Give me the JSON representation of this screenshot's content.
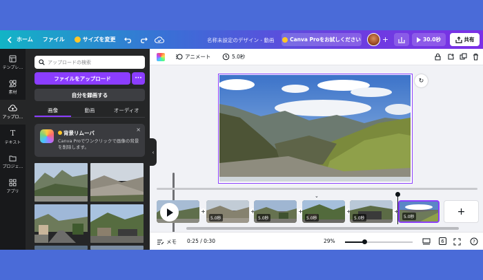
{
  "topbar": {
    "home_label": "ホーム",
    "file_label": "ファイル",
    "resize_label": "サイズを変更",
    "doc_title": "名称未設定のデザイン - 動画",
    "try_pro_label": "Canva Proをお試しください",
    "play_label": "30.0秒",
    "share_label": "共有"
  },
  "rail": {
    "items": [
      {
        "label": "テンプレ…",
        "icon": "template-icon"
      },
      {
        "label": "素材",
        "icon": "elements-icon"
      },
      {
        "label": "アップロ…",
        "icon": "upload-cloud-icon"
      },
      {
        "label": "テキスト",
        "icon": "text-icon"
      },
      {
        "label": "プロジェ…",
        "icon": "folder-icon"
      },
      {
        "label": "アプリ",
        "icon": "apps-icon"
      }
    ]
  },
  "panel": {
    "search_placeholder": "アップロードの検索",
    "upload_label": "ファイルをアップロード",
    "more_label": "···",
    "record_label": "自分を録画する",
    "tabs": [
      "画像",
      "動画",
      "オーディオ"
    ],
    "promo": {
      "title": "背景リムーバ",
      "desc": "Canva Proでワンクリックで画像の背景を削除します。",
      "close": "×"
    }
  },
  "editor": {
    "animate_label": "アニメート",
    "duration_label": "5.0秒"
  },
  "timeline": {
    "clips": [
      {
        "duration": ""
      },
      {
        "duration": "5.0秒"
      },
      {
        "duration": "5.0秒"
      },
      {
        "duration": "5.0秒"
      },
      {
        "duration": "5.0秒"
      },
      {
        "duration": "5.0秒"
      }
    ],
    "add_label": "+"
  },
  "bottombar": {
    "notes_label": "メモ",
    "time_label": "0:25 / 0:30",
    "zoom_label": "29%",
    "zoom_fraction": 0.29,
    "page_count": "6"
  },
  "colors": {
    "accent": "#8b3dff",
    "background": "#4a6bd8",
    "panel": "#252627",
    "rail": "#18191b"
  }
}
